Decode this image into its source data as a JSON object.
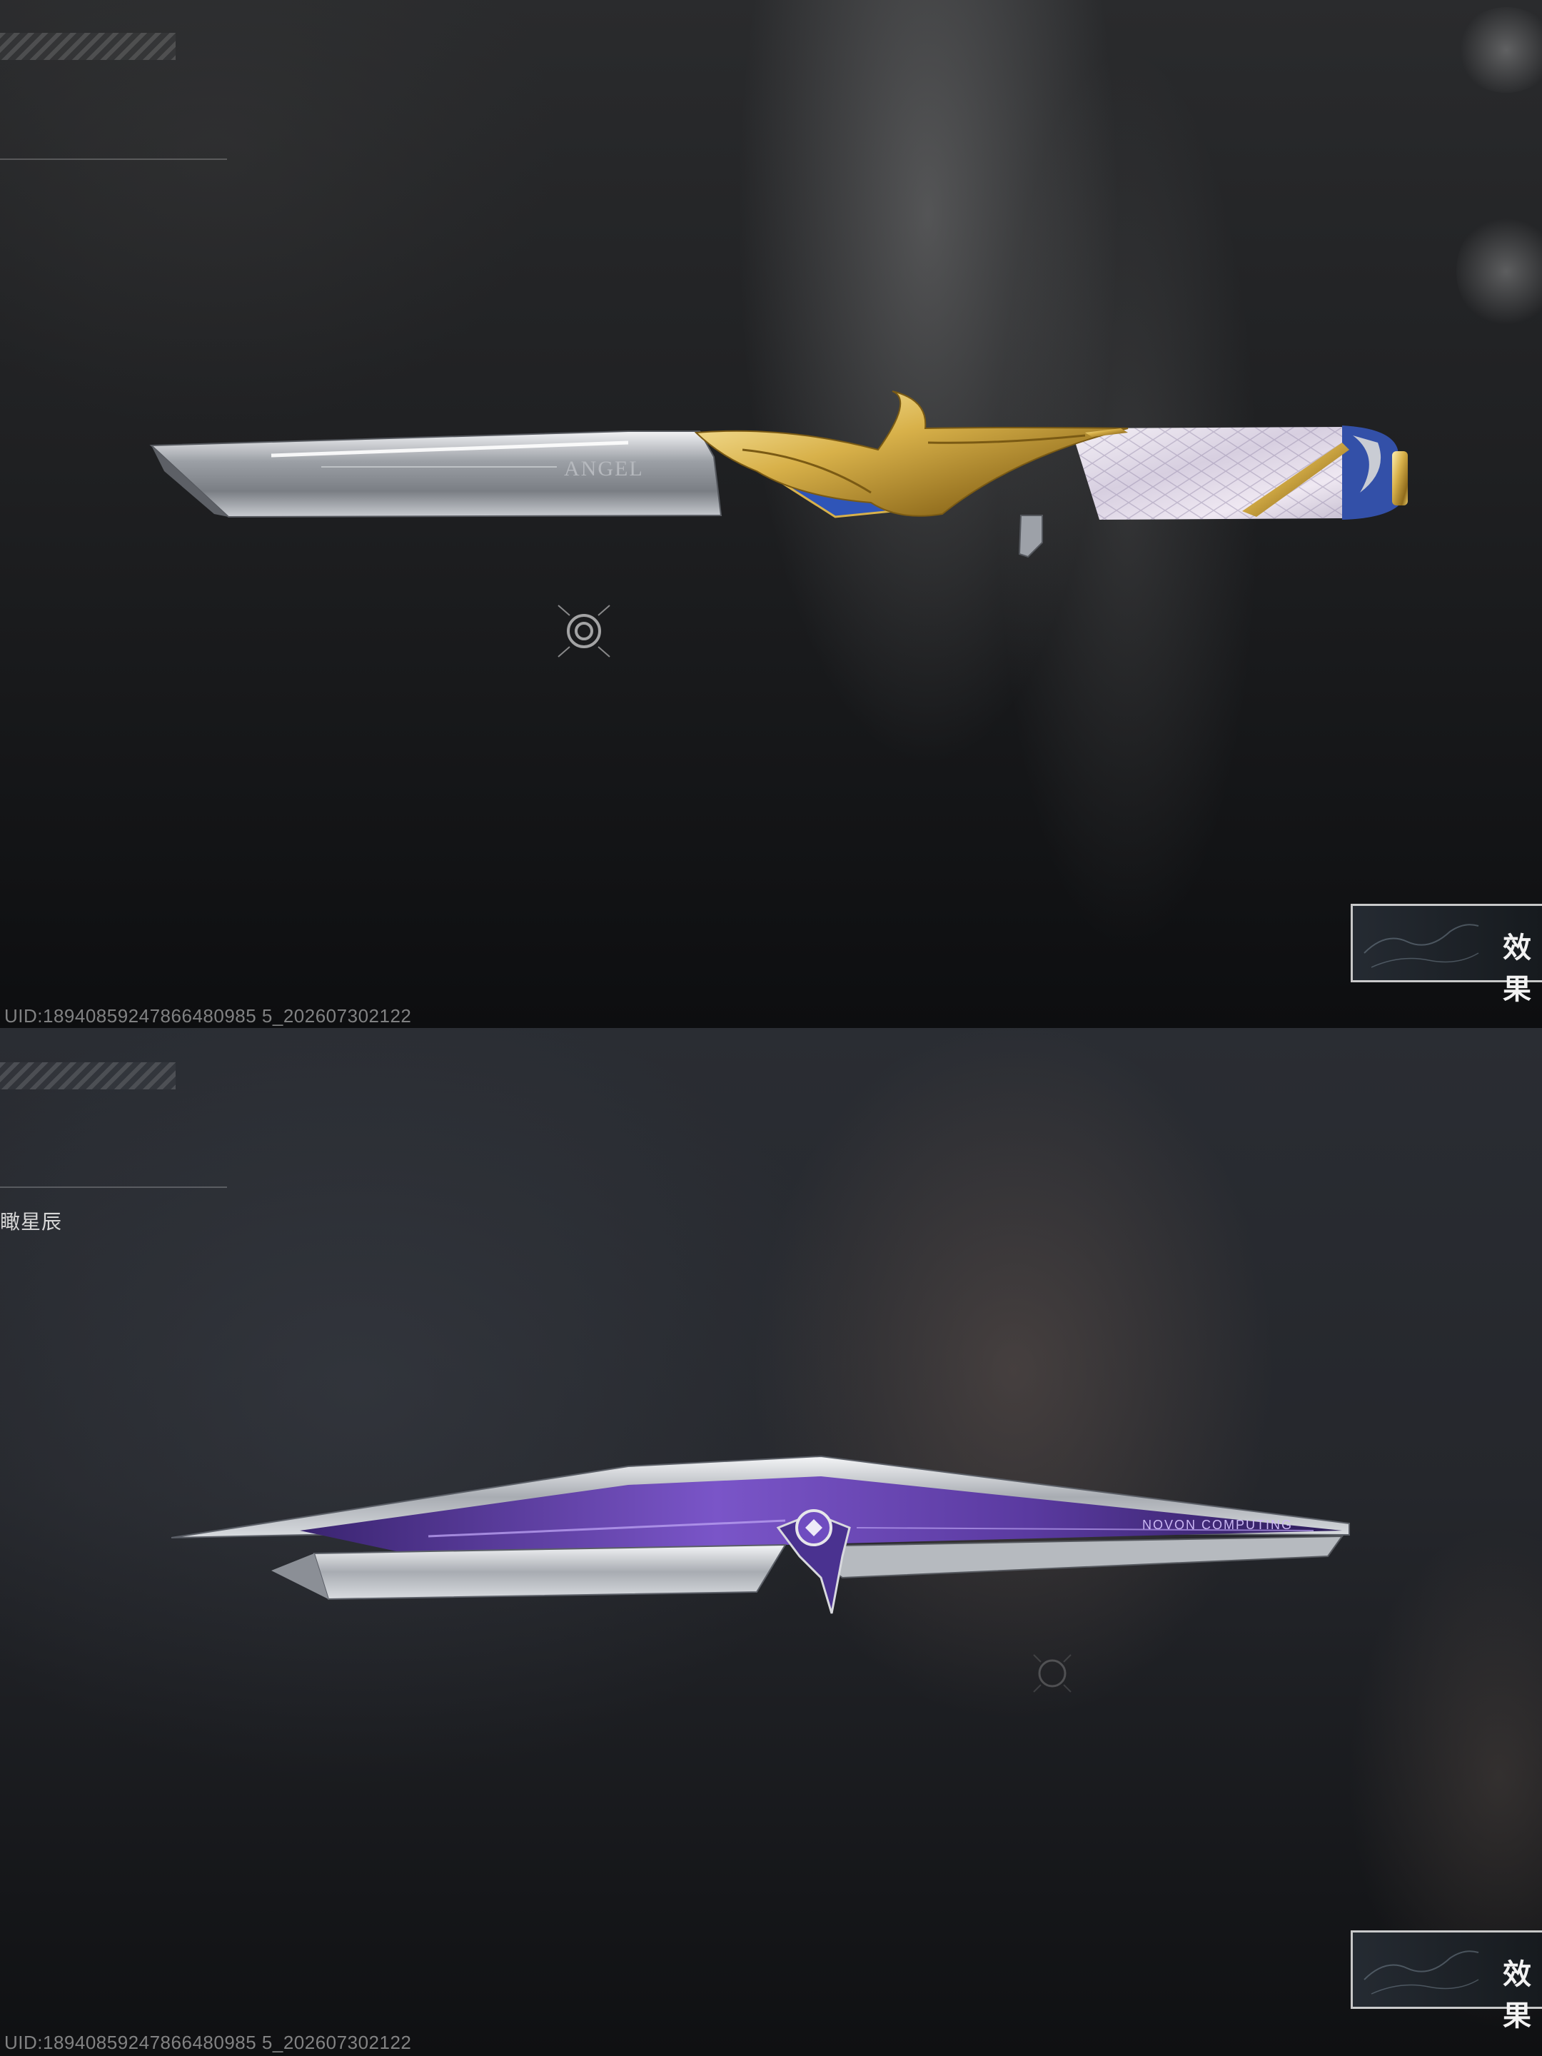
{
  "top_panel": {
    "skin_name": "",
    "uid": "UID:18940859247866480985 5_202607302122",
    "effect_button_label": "效果",
    "blade_engraving": "ANGEL",
    "inspect_icon": "focus-target-icon"
  },
  "bottom_panel": {
    "skin_name": "瞰星辰",
    "uid": "UID:18940859247866480985 5_202607302122",
    "effect_button_label": "效果",
    "handle_engraving": "NOVON COMPUTING",
    "inspect_icon": "focus-ring-icon"
  },
  "colors": {
    "accent_purple": "#7a55c8",
    "gold": "#d8b14a",
    "sapphire": "#2f55b8",
    "steel": "#c8ccd2"
  }
}
